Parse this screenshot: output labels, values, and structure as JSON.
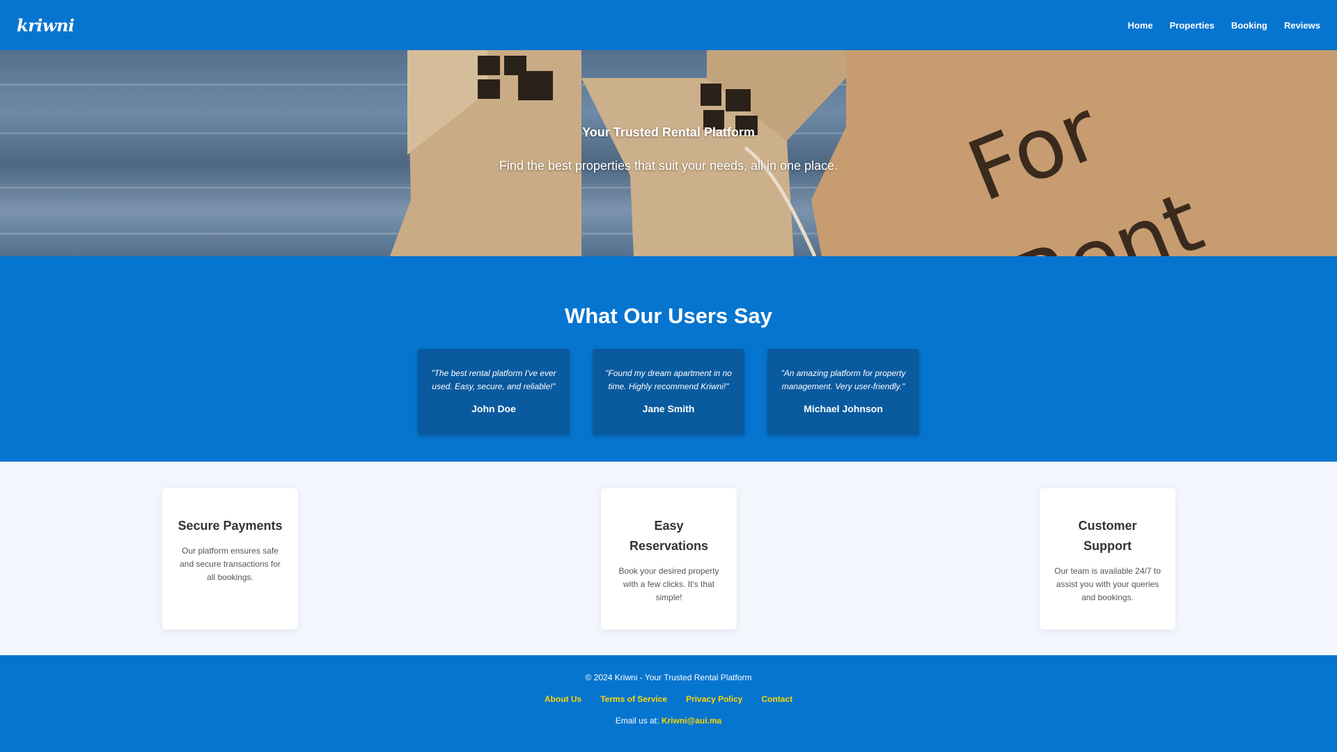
{
  "header": {
    "logo_text": "kriwni",
    "nav": [
      {
        "label": "Home"
      },
      {
        "label": "Properties"
      },
      {
        "label": "Booking"
      },
      {
        "label": "Reviews"
      }
    ]
  },
  "hero": {
    "title": "Your Trusted Rental Platform",
    "subtitle": "Find the best properties that suit your needs, all in one place.",
    "image_sign_text": "For Rent"
  },
  "testimonials": {
    "heading": "What Our Users Say",
    "items": [
      {
        "quote": "\"The best rental platform I've ever used. Easy, secure, and reliable!\"",
        "name": "John Doe"
      },
      {
        "quote": "\"Found my dream apartment in no time. Highly recommend Kriwni!\"",
        "name": "Jane Smith"
      },
      {
        "quote": "\"An amazing platform for property management. Very user-friendly.\"",
        "name": "Michael Johnson"
      }
    ]
  },
  "features": [
    {
      "title": "Secure Payments",
      "description": "Our platform ensures safe and secure transactions for all bookings."
    },
    {
      "title": "Easy Reservations",
      "description": "Book your desired property with a few clicks. It's that simple!"
    },
    {
      "title": "Customer Support",
      "description": "Our team is available 24/7 to assist you with your queries and bookings."
    }
  ],
  "footer": {
    "copyright": "© 2024 Kriwni - Your Trusted Rental Platform",
    "links": [
      {
        "label": "About Us"
      },
      {
        "label": "Terms of Service"
      },
      {
        "label": "Privacy Policy"
      },
      {
        "label": "Contact"
      }
    ],
    "email_prefix": "Email us at:",
    "email": "Kriwni@aui.ma"
  },
  "colors": {
    "primary": "#0675cf",
    "card_dark": "#0a5a9f",
    "link_accent": "#ffd500",
    "features_bg": "#f3f7fd"
  }
}
